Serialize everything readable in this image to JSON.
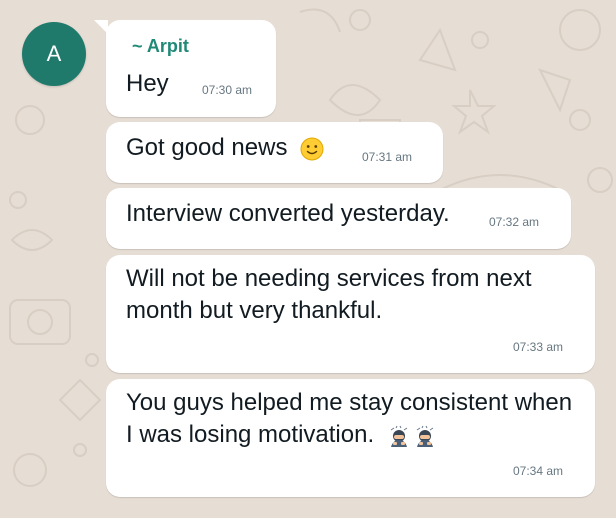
{
  "chat": {
    "avatar_letter": "A",
    "sender": "~ Arpit",
    "messages": [
      {
        "text": "Hey",
        "time": "07:30 am"
      },
      {
        "text": "Got good news",
        "emoji": "slightly-smiling-face",
        "time": "07:31 am"
      },
      {
        "text": "Interview converted yesterday.",
        "time": "07:32 am"
      },
      {
        "text": "Will not be needing services from next month but very thankful.",
        "time": "07:33 am"
      },
      {
        "text": "You guys helped me stay consistent when I was losing motivation.",
        "emoji": "bowing-person x2",
        "time": "07:34 am"
      }
    ]
  },
  "colors": {
    "wallpaper": "#e6ddd4",
    "bubble": "#ffffff",
    "avatar": "#1f7a6b",
    "sender_name": "#1f8a78",
    "timestamp": "#667781"
  }
}
